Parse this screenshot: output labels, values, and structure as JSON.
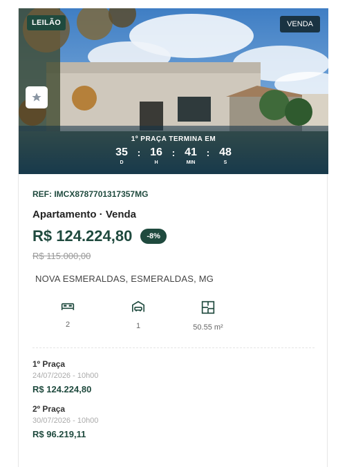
{
  "listing": {
    "auction_badge": "LEILÃO",
    "sale_badge": "VENDA",
    "countdown": {
      "title": "1º PRAÇA TERMINA EM",
      "days": "35",
      "hours": "16",
      "minutes": "41",
      "seconds": "48",
      "days_label": "D",
      "hours_label": "H",
      "minutes_label": "MIN",
      "seconds_label": "S",
      "separator": ":"
    },
    "ref": "REF: IMCX8787701317357MG",
    "type": "Apartamento · Venda",
    "price": "R$ 124.224,80",
    "discount": "-8%",
    "old_price": "R$ 115.000,00",
    "address": "NOVA ESMERALDAS, ESMERALDAS, MG",
    "features": {
      "bedrooms": "2",
      "garage": "1",
      "area": "50.55 m²"
    },
    "rounds": [
      {
        "label": "1º Praça",
        "date": "24/07/2026 - 10h00",
        "price": "R$ 124.224,80"
      },
      {
        "label": "2º Praça",
        "date": "30/07/2026 - 10h00",
        "price": "R$ 96.219,11"
      }
    ]
  },
  "colors": {
    "brand": "#1f4a3e",
    "venda_badge": "#1a3342"
  },
  "icons": [
    "star-icon",
    "bed-icon",
    "garage-icon",
    "floorplan-icon"
  ]
}
